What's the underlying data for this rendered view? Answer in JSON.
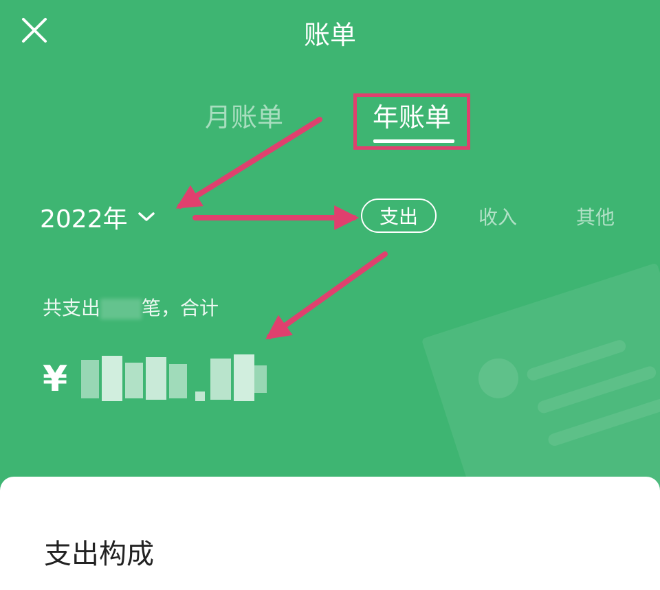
{
  "header": {
    "title": "账单",
    "close_icon": "close-icon"
  },
  "tabs": [
    {
      "label": "月账单",
      "active": false
    },
    {
      "label": "年账单",
      "active": true
    }
  ],
  "year_selector": {
    "value": "2022年",
    "icon": "chevron-down-icon"
  },
  "filters": [
    {
      "label": "支出",
      "active": true
    },
    {
      "label": "收入",
      "active": false
    },
    {
      "label": "其他",
      "active": false
    }
  ],
  "summary": {
    "prefix": "共支出",
    "suffix": "笔，合计",
    "currency": "¥"
  },
  "sheet": {
    "title": "支出构成"
  },
  "colors": {
    "header_bg": "#3eb572",
    "annotation": "#e0406e",
    "sheet_bg": "#ffffff"
  }
}
